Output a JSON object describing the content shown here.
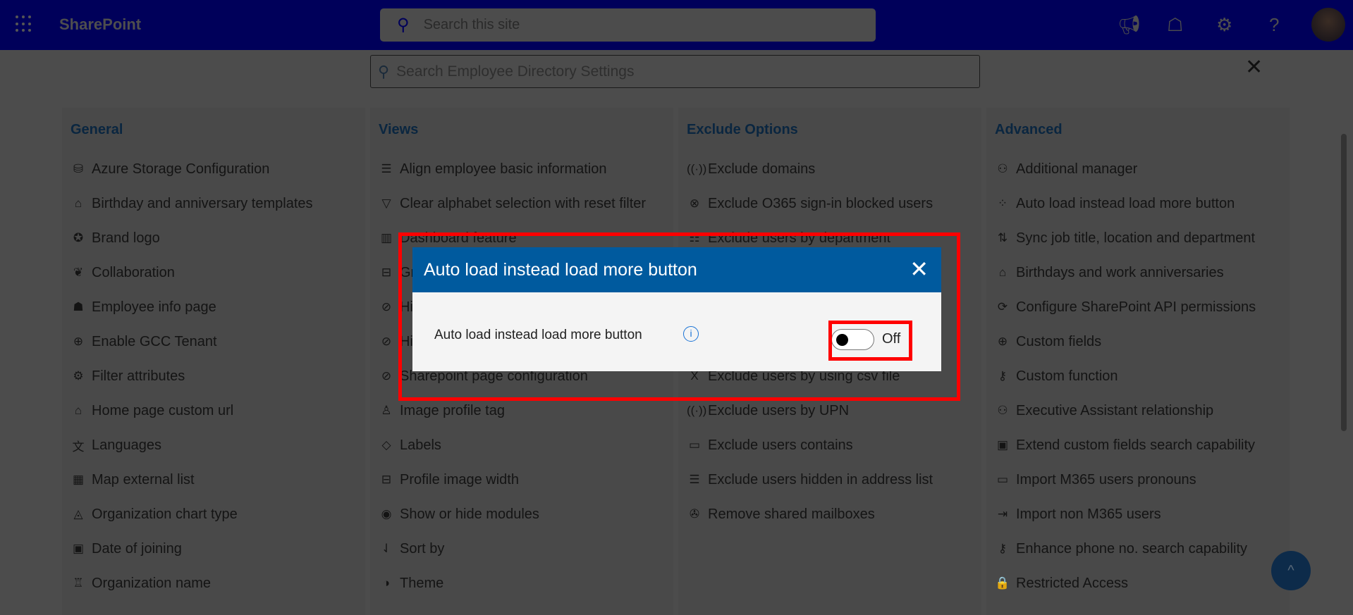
{
  "header": {
    "app_name": "SharePoint",
    "search_placeholder": "Search this site",
    "icons": [
      "waffle-icon",
      "megaphone-icon",
      "feedback-icon",
      "gear-icon",
      "help-icon",
      "avatar"
    ]
  },
  "settings": {
    "search_placeholder": "Search Employee Directory Settings"
  },
  "columns": [
    {
      "title": "General",
      "items": [
        {
          "label": "Azure Storage Configuration",
          "icon": "⛁"
        },
        {
          "label": "Birthday and anniversary templates",
          "icon": "⌂"
        },
        {
          "label": "Brand logo",
          "icon": "✪"
        },
        {
          "label": "Collaboration",
          "icon": "❦"
        },
        {
          "label": "Employee info page",
          "icon": "☗"
        },
        {
          "label": "Enable GCC Tenant",
          "icon": "⊕"
        },
        {
          "label": "Filter attributes",
          "icon": "⚙"
        },
        {
          "label": "Home page custom url",
          "icon": "⌂"
        },
        {
          "label": "Languages",
          "icon": "文"
        },
        {
          "label": "Map external list",
          "icon": "▦"
        },
        {
          "label": "Organization chart type",
          "icon": "◬"
        },
        {
          "label": "Date of joining",
          "icon": "▣"
        },
        {
          "label": "Organization name",
          "icon": "♖"
        }
      ]
    },
    {
      "title": "Views",
      "items": [
        {
          "label": "Align employee basic information",
          "icon": "☰"
        },
        {
          "label": "Clear alphabet selection with reset filter",
          "icon": "▽"
        },
        {
          "label": "Dashboard feature",
          "icon": "▥"
        },
        {
          "label": "Gr",
          "icon": "⊟"
        },
        {
          "label": "Hi",
          "icon": "⊘"
        },
        {
          "label": "Hi",
          "icon": "⊘"
        },
        {
          "label": "Sharepoint page configuration",
          "icon": "⊘"
        },
        {
          "label": "Image profile tag",
          "icon": "♙"
        },
        {
          "label": "Labels",
          "icon": "◇"
        },
        {
          "label": "Profile image width",
          "icon": "⊟"
        },
        {
          "label": "Show or hide modules",
          "icon": "◉"
        },
        {
          "label": "Sort by",
          "icon": "⇃"
        },
        {
          "label": "Theme",
          "icon": "◑"
        }
      ]
    },
    {
      "title": "Exclude Options",
      "items": [
        {
          "label": "Exclude domains",
          "icon": "((·))"
        },
        {
          "label": "Exclude O365 sign-in blocked users",
          "icon": "⊗"
        },
        {
          "label": "Exclude users by department",
          "icon": "☷"
        },
        {
          "label": "",
          "icon": ""
        },
        {
          "label": "",
          "icon": ""
        },
        {
          "label": "",
          "icon": ""
        },
        {
          "label": "Exclude users by using csv file",
          "icon": "X"
        },
        {
          "label": "Exclude users by UPN",
          "icon": "((·))"
        },
        {
          "label": "Exclude users contains",
          "icon": "▭"
        },
        {
          "label": "Exclude users hidden in address list",
          "icon": "☰"
        },
        {
          "label": "Remove shared mailboxes",
          "icon": "✇"
        }
      ]
    },
    {
      "title": "Advanced",
      "items": [
        {
          "label": "Additional manager",
          "icon": "⚇"
        },
        {
          "label": "Auto load instead load more button",
          "icon": "⁘"
        },
        {
          "label": "Sync job title, location and department",
          "icon": "⇅"
        },
        {
          "label": "Birthdays and work anniversaries",
          "icon": "⌂"
        },
        {
          "label": "Configure SharePoint API permissions",
          "icon": "⟳"
        },
        {
          "label": "Custom fields",
          "icon": "⊕"
        },
        {
          "label": "Custom function",
          "icon": "⚷"
        },
        {
          "label": "Executive Assistant relationship",
          "icon": "⚇"
        },
        {
          "label": "Extend custom fields search capability",
          "icon": "▣"
        },
        {
          "label": "Import M365 users pronouns",
          "icon": "▭"
        },
        {
          "label": "Import non M365 users",
          "icon": "⇥"
        },
        {
          "label": "Enhance phone no. search capability",
          "icon": "⚷"
        },
        {
          "label": "Restricted Access",
          "icon": "🔒"
        }
      ]
    }
  ],
  "dialog": {
    "title": "Auto load instead load more button",
    "setting_label": "Auto load instead load more button",
    "toggle_state": "Off",
    "toggle_on": false
  },
  "colors": {
    "dialog_header": "#005a9e",
    "highlight": "#ff0000",
    "topbar": "#00005a"
  }
}
